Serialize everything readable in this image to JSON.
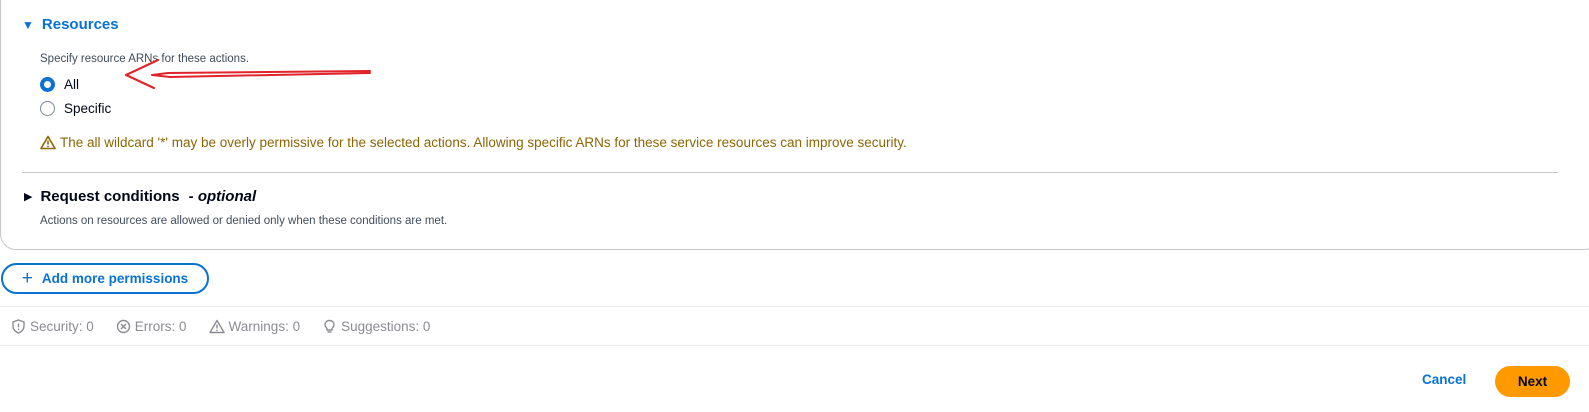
{
  "resources": {
    "caret": "▼",
    "title": "Resources",
    "description": "Specify resource ARNs for these actions.",
    "options": [
      {
        "label": "All",
        "checked": true
      },
      {
        "label": "Specific",
        "checked": false
      }
    ],
    "warning": "The all wildcard '*' may be overly permissive for the selected actions. Allowing specific ARNs for these service resources can improve security.",
    "warning_icon": "warning-triangle-icon"
  },
  "conditions": {
    "caret": "▶",
    "title": "Request conditions",
    "optional": "- optional",
    "description": "Actions on resources are allowed or denied only when these conditions are met."
  },
  "add_permissions": {
    "icon": "+",
    "label": "Add more permissions"
  },
  "status": [
    {
      "label": "Security: 0",
      "icon": "shield-icon"
    },
    {
      "label": "Errors: 0",
      "icon": "error-circle-icon"
    },
    {
      "label": "Warnings: 0",
      "icon": "warning-triangle-icon"
    },
    {
      "label": "Suggestions: 0",
      "icon": "lightbulb-icon"
    }
  ],
  "footer": {
    "cancel_label": "Cancel",
    "next_label": "Next"
  },
  "colors": {
    "link_blue": "#0972d3",
    "warning_text": "#8d6605",
    "primary_button": "#ff9900",
    "annotation_arrow": "#e0242b"
  }
}
